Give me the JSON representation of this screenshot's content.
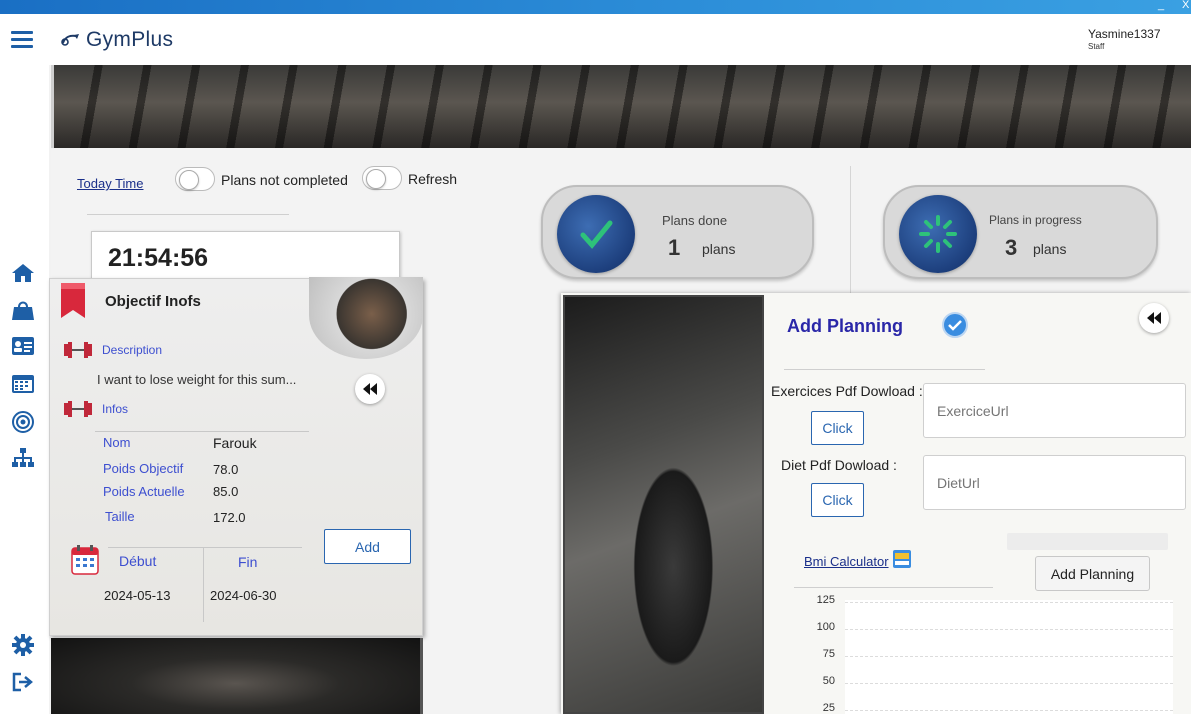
{
  "window": {
    "minimize": "_",
    "close": "X"
  },
  "header": {
    "app_name": "GymPlus",
    "user_name": "Yasmine1337",
    "user_role": "Staff"
  },
  "toolbar": {
    "today_link": "Today Time",
    "toggle_plans": "Plans not completed",
    "toggle_refresh": "Refresh"
  },
  "clock": {
    "time": "21:54:56"
  },
  "stats": {
    "done": {
      "label": "Plans done",
      "count": "1",
      "unit": "plans"
    },
    "progress": {
      "label": "Plans in progress",
      "count": "3",
      "unit": "plans"
    }
  },
  "objective": {
    "title": "Objectif Inofs",
    "description_label": "Description",
    "description_text": "I want to lose weight for this sum...",
    "infos_label": "Infos",
    "rows": [
      {
        "label": "Nom",
        "value": "Farouk"
      },
      {
        "label": "Poids Objectif",
        "value": "78.0"
      },
      {
        "label": "Poids Actuelle",
        "value": "85.0"
      },
      {
        "label": "Taille",
        "value": "172.0"
      }
    ],
    "debut_label": "Début",
    "debut_value": "2024-05-13",
    "fin_label": "Fin",
    "fin_value": "2024-06-30",
    "add_label": "Add"
  },
  "planning": {
    "title": "Add Planning",
    "exercise_label": "Exercices Pdf Dowload :",
    "exercise_click": "Click",
    "exercise_placeholder": "ExerciceUrl",
    "diet_label": "Diet Pdf Dowload :",
    "diet_click": "Click",
    "diet_placeholder": "DietUrl",
    "bmi_link": "Bmi Calculator",
    "submit_label": "Add Planning"
  },
  "chart_data": {
    "type": "line",
    "y_ticks": [
      "125",
      "100",
      "75",
      "50",
      "25"
    ],
    "ylim": [
      25,
      125
    ],
    "grid": true
  },
  "colors": {
    "accent": "#1e5fa6",
    "link": "#1a2f8a",
    "label_blue": "#3d4fd0",
    "title_blue": "#2a27a8"
  }
}
